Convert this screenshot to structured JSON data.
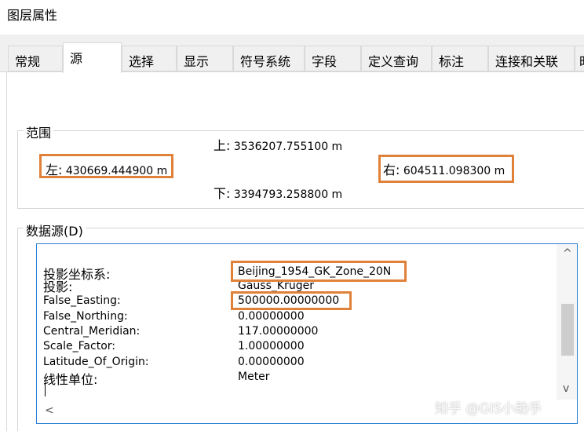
{
  "window": {
    "title": "图层属性"
  },
  "tabs": [
    {
      "label": "常规",
      "active": false
    },
    {
      "label": "源",
      "active": true
    },
    {
      "label": "选择",
      "active": false
    },
    {
      "label": "显示",
      "active": false
    },
    {
      "label": "符号系统",
      "active": false
    },
    {
      "label": "字段",
      "active": false
    },
    {
      "label": "定义查询",
      "active": false
    },
    {
      "label": "标注",
      "active": false
    },
    {
      "label": "连接和关联",
      "active": false
    },
    {
      "label": "时",
      "active": false
    }
  ],
  "extent": {
    "group_label": "范围",
    "top_label": "上:",
    "top_value": "3536207.755100 m",
    "left_label": "左:",
    "left_value": "430669.444900 m",
    "right_label": "右:",
    "right_value": "604511.098300 m",
    "bottom_label": "下:",
    "bottom_value": "3394793.258800 m"
  },
  "datasource": {
    "group_label": "数据源(D)",
    "properties": [
      {
        "name": "投影坐标系:",
        "value": "Beijing_1954_GK_Zone_20N"
      },
      {
        "name": "投影:",
        "value": "Gauss_Kruger"
      },
      {
        "name": "False_Easting:",
        "value": "500000.00000000"
      },
      {
        "name": "False_Northing:",
        "value": "0.00000000"
      },
      {
        "name": "Central_Meridian:",
        "value": "117.00000000"
      },
      {
        "name": "Scale_Factor:",
        "value": "1.00000000"
      },
      {
        "name": "Latitude_Of_Origin:",
        "value": "0.00000000"
      },
      {
        "name": "线性单位:",
        "value": "Meter"
      }
    ]
  },
  "scroll": {
    "up": "^",
    "down": "v",
    "left": "<"
  },
  "watermark": "知乎 @GIS小助手",
  "colors": {
    "highlight": "#e0813a",
    "listbox_border": "#2b7fd6"
  }
}
